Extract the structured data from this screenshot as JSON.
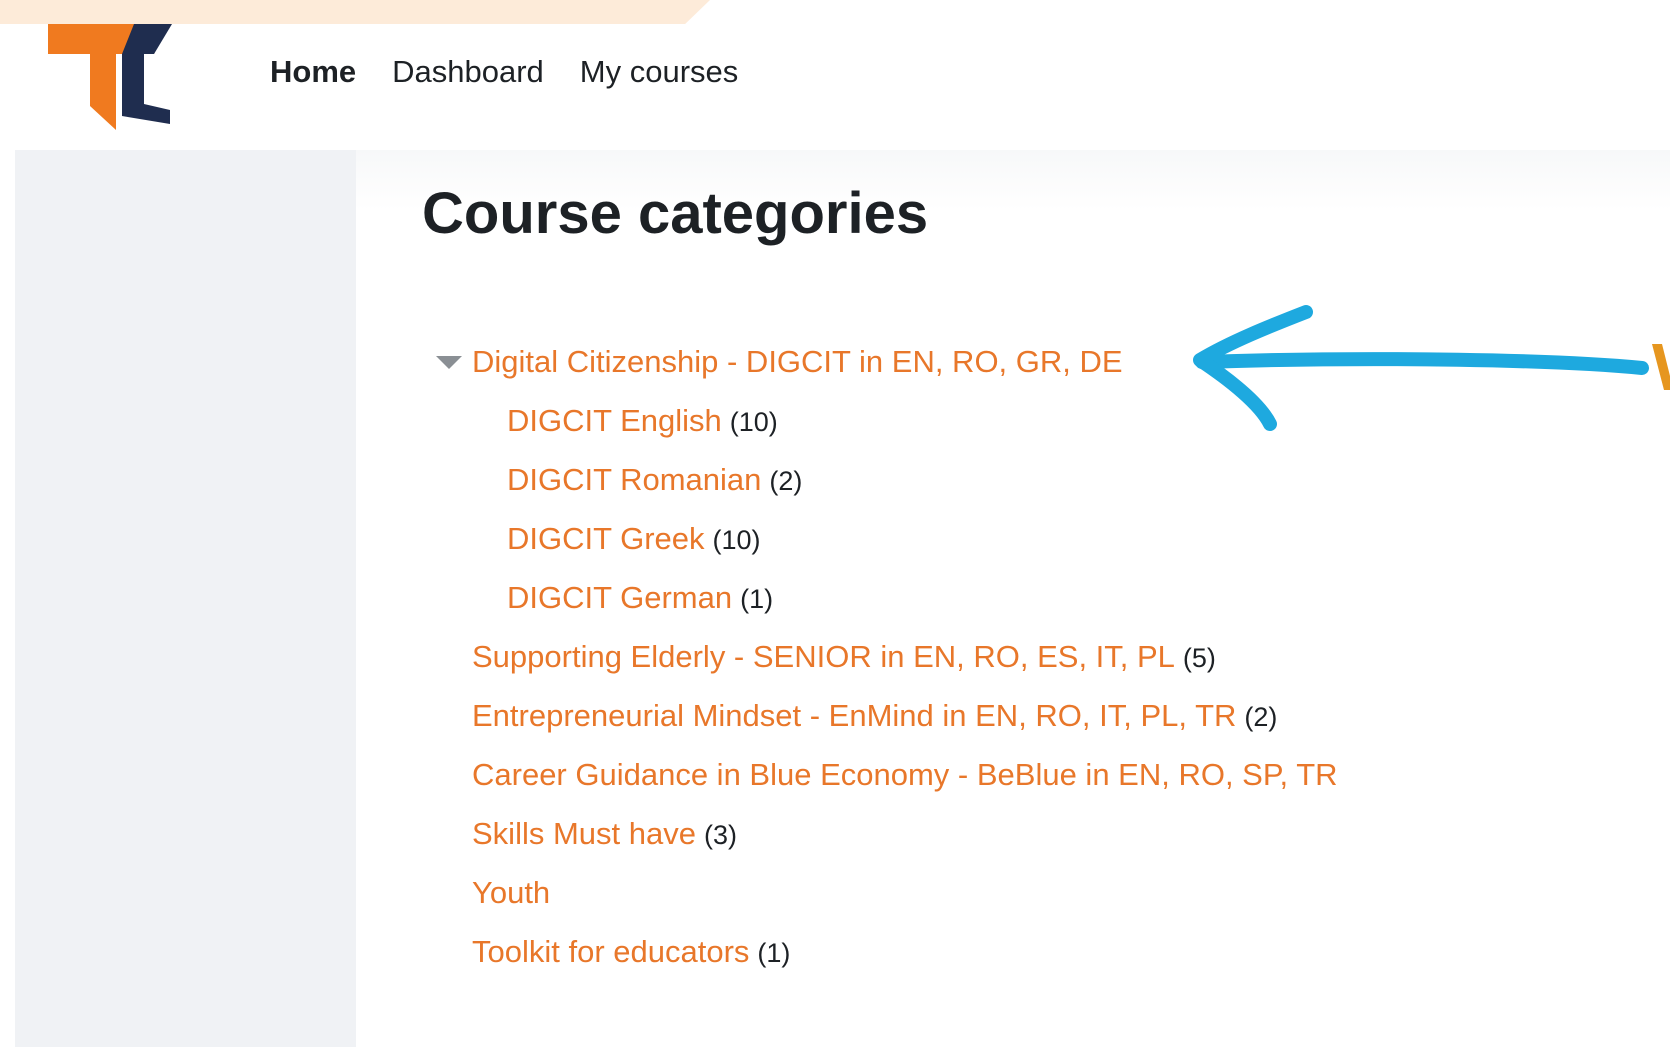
{
  "nav": {
    "home": "Home",
    "dashboard": "Dashboard",
    "my_courses": "My courses"
  },
  "page_title": "Course categories",
  "categories": [
    {
      "label": "Digital Citizenship - DIGCIT in EN, RO, GR, DE",
      "count": "",
      "expanded": true
    },
    {
      "label": "DIGCIT English",
      "count": "(10)"
    },
    {
      "label": "DIGCIT Romanian",
      "count": "(2)"
    },
    {
      "label": "DIGCIT Greek",
      "count": "(10)"
    },
    {
      "label": "DIGCIT German",
      "count": "(1)"
    },
    {
      "label": "Supporting Elderly - SENIOR in EN, RO, ES, IT, PL",
      "count": "(5)"
    },
    {
      "label": "Entrepreneurial Mindset - EnMind in EN, RO, IT, PL, TR",
      "count": "(2)"
    },
    {
      "label": "Career Guidance in Blue Economy - BeBlue in EN, RO, SP, TR",
      "count": ""
    },
    {
      "label": "Skills Must have",
      "count": "(3)"
    },
    {
      "label": "Youth",
      "count": ""
    },
    {
      "label": "Toolkit for educators",
      "count": "(1)"
    }
  ],
  "icons": {
    "logo": "tc-logo",
    "toggle": "caret-down-icon",
    "annotation": "annotation-arrow"
  },
  "colors": {
    "link": "#e8772a",
    "logo_orange": "#f07a1f",
    "logo_navy": "#1f2d4f",
    "annotation_blue": "#1ea9df",
    "banner_peach": "#fdebd9"
  }
}
